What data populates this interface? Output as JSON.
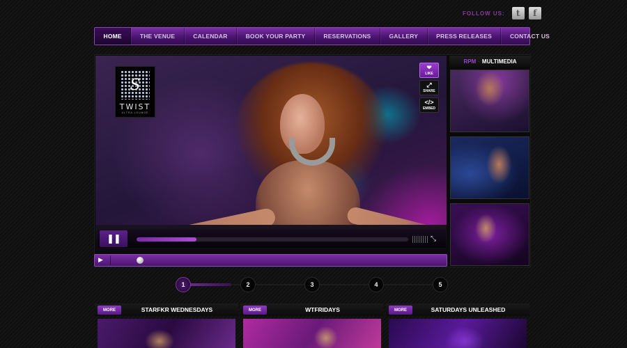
{
  "follow": {
    "label": "FOLLOW US:",
    "twitter_glyph": "t",
    "facebook_glyph": "f"
  },
  "nav": {
    "items": [
      {
        "label": "HOME",
        "active": true
      },
      {
        "label": "THE VENUE"
      },
      {
        "label": "CALENDAR"
      },
      {
        "label": "BOOK YOUR PARTY"
      },
      {
        "label": "RESERVATIONS"
      },
      {
        "label": "GALLERY"
      },
      {
        "label": "PRESS RELEASES"
      },
      {
        "label": "CONTACT US"
      }
    ]
  },
  "hero": {
    "logo": {
      "letter": "S",
      "name": "TWIST",
      "subtitle": "ULTRA LOUNGE"
    },
    "actions": [
      {
        "label": "LIKE",
        "icon": "heart-icon",
        "glyph": "❤"
      },
      {
        "label": "SHARE",
        "icon": "share-icon",
        "glyph": "⤢"
      },
      {
        "label": "EMBED",
        "icon": "embed-icon",
        "glyph": "</>"
      }
    ]
  },
  "player": {
    "pause_glyph": "❚❚",
    "progress": 0.22,
    "fullscreen_glyph": "⤡"
  },
  "track": {
    "play_glyph": "▶",
    "position": 0.08
  },
  "media": {
    "brand": "RPM",
    "separator": "·",
    "title": "MULTIMEDIA"
  },
  "pager": {
    "pages": [
      "1",
      "2",
      "3",
      "4",
      "5"
    ],
    "active": 0
  },
  "events": [
    {
      "more": "MORE",
      "title": "STARFKR WEDNESDAYS"
    },
    {
      "more": "MORE",
      "title": "WTFRIDAYS"
    },
    {
      "more": "MORE",
      "title": "SATURDAYS UNLEASHED"
    }
  ],
  "colors": {
    "accent": "#7b2fa6",
    "accent_light": "#a040c8",
    "background": "#111111"
  }
}
